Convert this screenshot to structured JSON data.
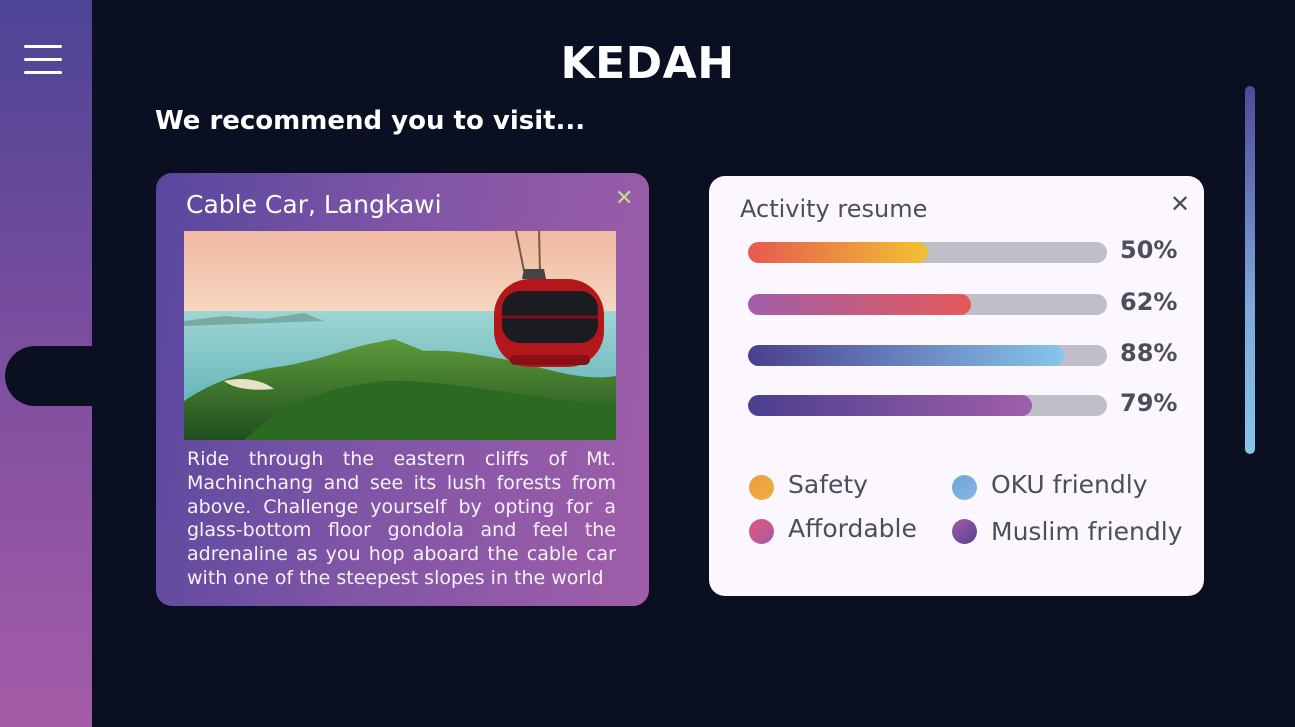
{
  "header": {
    "title": "KEDAH",
    "subtitle": "We recommend you to visit..."
  },
  "sidebar": {
    "menu_icon": "hamburger-menu-icon"
  },
  "place_card": {
    "title": "Cable Car, Langkawi",
    "close_icon": "close-icon",
    "close_glyph": "✕",
    "description": "Ride through the eastern cliffs of Mt. Machinchang and see its lush forests from above. Challenge yourself by opting for a glass-bottom floor gondola and feel the adrenaline as you hop aboard the cable car with one of the steepest slopes in the world"
  },
  "activity": {
    "title": "Activity resume",
    "close_glyph": "✕",
    "bars": [
      {
        "percent": 50,
        "label": "50%",
        "colors": [
          "#e7594f",
          "#f1c232"
        ]
      },
      {
        "percent": 62,
        "label": "62%",
        "colors": [
          "#a05ea9",
          "#e55a5a"
        ]
      },
      {
        "percent": 88,
        "label": "88%",
        "colors": [
          "#4a3f8f",
          "#86c6ec"
        ]
      },
      {
        "percent": 79,
        "label": "79%",
        "colors": [
          "#4a3f8f",
          "#a05ea9"
        ]
      }
    ],
    "legend": [
      {
        "label": "Safety",
        "colors": [
          "#f29a3c",
          "#e7b23f"
        ]
      },
      {
        "label": "OKU friendly",
        "colors": [
          "#6aa6d8",
          "#8ab5e6"
        ]
      },
      {
        "label": "Affordable",
        "colors": [
          "#e9537a",
          "#a05ea9"
        ]
      },
      {
        "label": "Muslim friendly",
        "colors": [
          "#a05ea9",
          "#5a3e90"
        ]
      }
    ]
  }
}
